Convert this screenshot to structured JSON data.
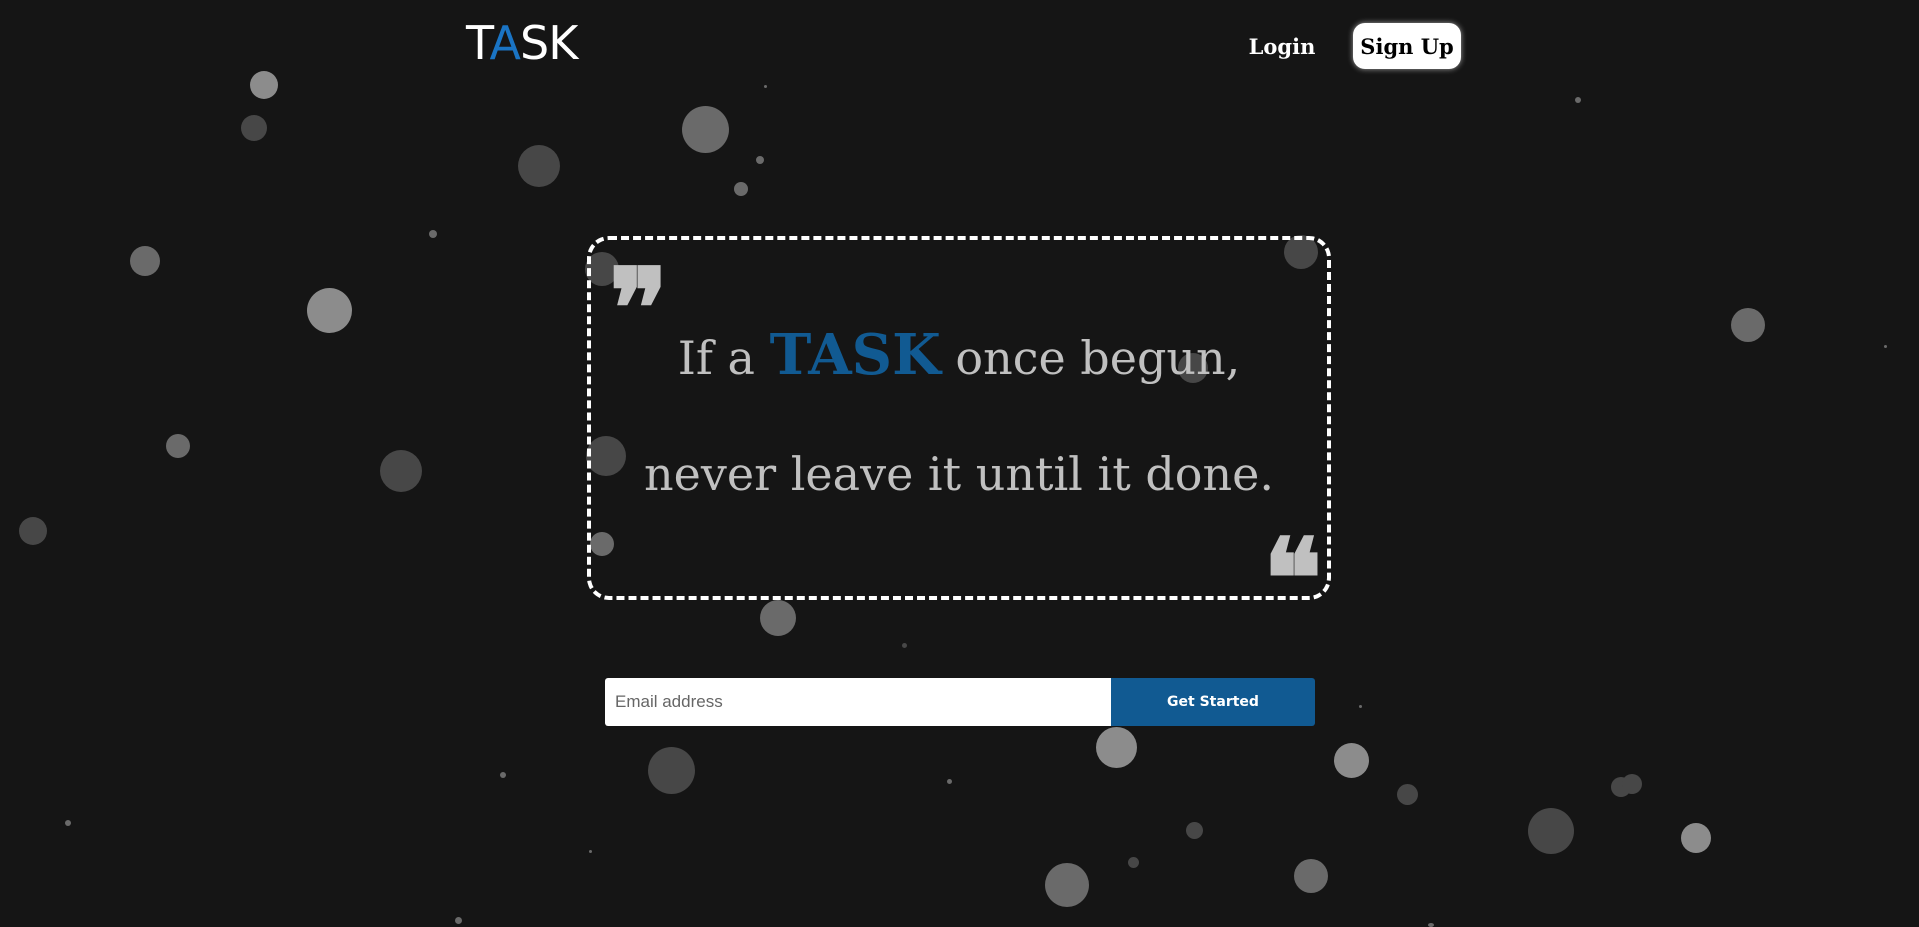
{
  "header": {
    "logo": {
      "part1": "T",
      "accent": "A",
      "part2": "SK"
    },
    "login_label": "Login",
    "signup_label": "Sign Up"
  },
  "quote": {
    "open_mark": "❞",
    "close_mark": "❝",
    "line1_before": "If a ",
    "line1_highlight": "TASK",
    "line1_after": " once begun,",
    "line2": "never leave it until it done."
  },
  "signup_form": {
    "email_placeholder": "Email address",
    "submit_label": "Get Started"
  },
  "colors": {
    "background": "#151515",
    "accent": "#115a92",
    "logo_accent": "#1a74c4",
    "quote_text": "#c0c0c0"
  }
}
